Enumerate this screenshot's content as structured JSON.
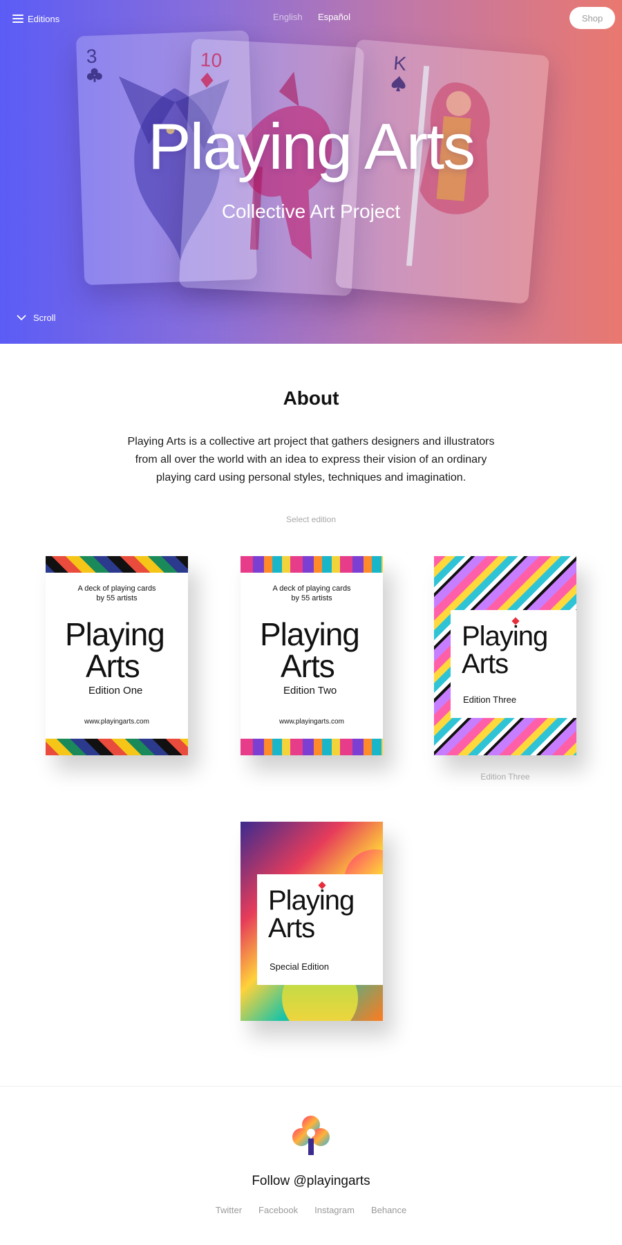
{
  "header": {
    "editions_label": "Editions",
    "lang_english": "English",
    "lang_spanish": "Español",
    "shop_label": "Shop"
  },
  "hero": {
    "title": "Playing Arts",
    "subtitle": "Collective Art Project",
    "scroll_label": "Scroll",
    "cards": [
      {
        "rank": "3",
        "suit": "clubs"
      },
      {
        "rank": "10",
        "suit": "diamonds"
      },
      {
        "rank": "K",
        "suit": "spades"
      }
    ]
  },
  "about": {
    "title": "About",
    "text": "Playing Arts is a collective art project that gathers designers and illustrators from all over the world with an idea to express their vision of an ordinary playing card using personal styles, techniques and imagination.",
    "select_label": "Select edition"
  },
  "decks": [
    {
      "tag_line1": "A deck of playing cards",
      "tag_line2": "by 55 artists",
      "word1": "Playing",
      "word2": "Arts",
      "edition": "Edition One",
      "url": "www.playingarts.com"
    },
    {
      "tag_line1": "A deck of playing cards",
      "tag_line2": "by 55 artists",
      "word1": "Playing",
      "word2": "Arts",
      "edition": "Edition Two",
      "url": "www.playingarts.com"
    },
    {
      "word1": "Playing",
      "word2": "Arts",
      "edition": "Edition Three",
      "caption": "Edition Three"
    },
    {
      "word1": "Playing",
      "word2": "Arts",
      "edition": "Special Edition"
    }
  ],
  "footer": {
    "follow": "Follow @playingarts",
    "links": [
      "Twitter",
      "Facebook",
      "Instagram",
      "Behance"
    ]
  },
  "colors": {
    "hero_gradient_start": "#5b5cf6",
    "hero_gradient_end": "#e9786f",
    "muted_text": "#a8a8a8"
  }
}
